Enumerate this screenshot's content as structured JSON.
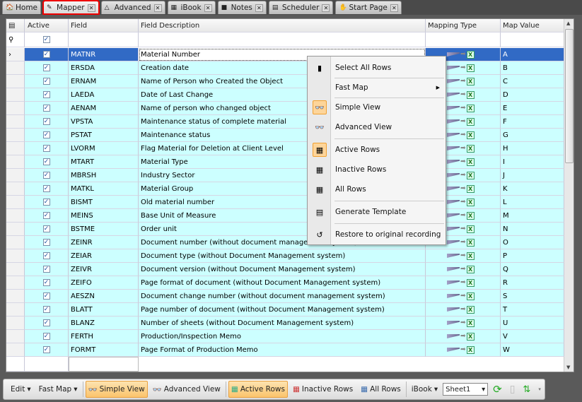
{
  "tabs": [
    {
      "label": "Home"
    },
    {
      "label": "Mapper",
      "active": true
    },
    {
      "label": "Advanced"
    },
    {
      "label": "iBook"
    },
    {
      "label": "Notes"
    },
    {
      "label": "Scheduler"
    },
    {
      "label": "Start Page"
    }
  ],
  "close_glyph": "✕",
  "grid": {
    "headers": {
      "active": "Active",
      "field": "Field",
      "description": "Field Description",
      "mapping_type": "Mapping Type",
      "map_value": "Map Value"
    },
    "rows": [
      {
        "field": "MATNR",
        "desc": "Material Number",
        "value": "A"
      },
      {
        "field": "ERSDA",
        "desc": "Creation date",
        "value": "B"
      },
      {
        "field": "ERNAM",
        "desc": "Name of Person who Created the Object",
        "value": "C"
      },
      {
        "field": "LAEDA",
        "desc": "Date of Last Change",
        "value": "D"
      },
      {
        "field": "AENAM",
        "desc": "Name of person who changed object",
        "value": "E"
      },
      {
        "field": "VPSTA",
        "desc": "Maintenance status of complete material",
        "value": "F"
      },
      {
        "field": "PSTAT",
        "desc": "Maintenance status",
        "value": "G"
      },
      {
        "field": "LVORM",
        "desc": "Flag Material for Deletion at Client Level",
        "value": "H"
      },
      {
        "field": "MTART",
        "desc": "Material Type",
        "value": "I"
      },
      {
        "field": "MBRSH",
        "desc": "Industry Sector",
        "value": "J"
      },
      {
        "field": "MATKL",
        "desc": "Material Group",
        "value": "K"
      },
      {
        "field": "BISMT",
        "desc": "Old material number",
        "value": "L"
      },
      {
        "field": "MEINS",
        "desc": "Base Unit of Measure",
        "value": "M"
      },
      {
        "field": "BSTME",
        "desc": "Order unit",
        "value": "N"
      },
      {
        "field": "ZEINR",
        "desc": "Document number (without document management system)",
        "value": "O"
      },
      {
        "field": "ZEIAR",
        "desc": "Document type (without Document Management system)",
        "value": "P"
      },
      {
        "field": "ZEIVR",
        "desc": "Document version (without Document Management system)",
        "value": "Q"
      },
      {
        "field": "ZEIFO",
        "desc": "Page format of document (without Document Management system)",
        "value": "R"
      },
      {
        "field": "AESZN",
        "desc": "Document change number (without document management system)",
        "value": "S"
      },
      {
        "field": "BLATT",
        "desc": "Page number of document (without Document Management system)",
        "value": "T"
      },
      {
        "field": "BLANZ",
        "desc": "Number of sheets (without Document Management system)",
        "value": "U"
      },
      {
        "field": "FERTH",
        "desc": "Production/Inspection Memo",
        "value": "V"
      },
      {
        "field": "FORMT",
        "desc": "Page Format of Production Memo",
        "value": "W"
      }
    ]
  },
  "context_menu": [
    "Select All Rows",
    "Fast Map",
    "Simple View",
    "Advanced View",
    "Active Rows",
    "Inactive Rows",
    "All Rows",
    "Generate Template",
    "Restore to original recording"
  ],
  "toolbar": {
    "edit": "Edit",
    "fast_map": "Fast Map",
    "simple_view": "Simple View",
    "advanced_view": "Advanced View",
    "active_rows": "Active Rows",
    "inactive_rows": "Inactive Rows",
    "all_rows": "All Rows",
    "ibook": "iBook",
    "sheet": "Sheet1"
  }
}
